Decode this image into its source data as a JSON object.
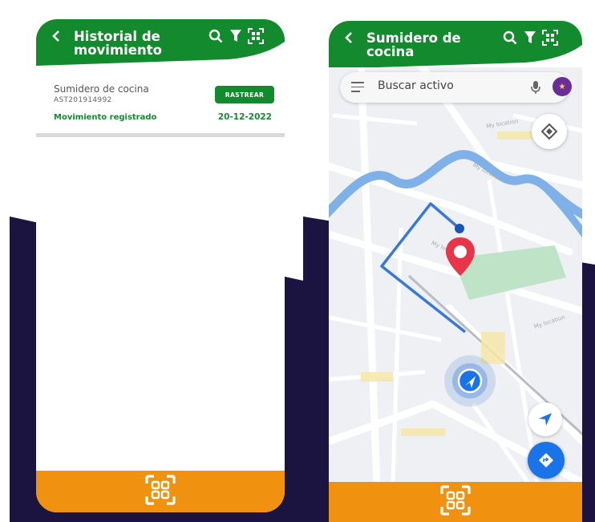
{
  "screens": [
    {
      "header": {
        "back_icon": "chevron-left-icon",
        "title": "Historial de movimiento"
      },
      "card": {
        "name": "Sumidero de cocina",
        "code": "AST201914992",
        "button": "RASTREAR",
        "status": "Movimiento registrado",
        "date": "20-12-2022"
      }
    },
    {
      "header": {
        "back_icon": "chevron-left-icon",
        "title": "Sumidero de cocina"
      },
      "search": {
        "placeholder": "Buscar activo"
      },
      "street_label": "My location"
    }
  ],
  "colors": {
    "brand_green": "#138a2e",
    "accent_orange": "#f0920f",
    "navy": "#1b1440",
    "route_blue": "#3a78d8"
  }
}
